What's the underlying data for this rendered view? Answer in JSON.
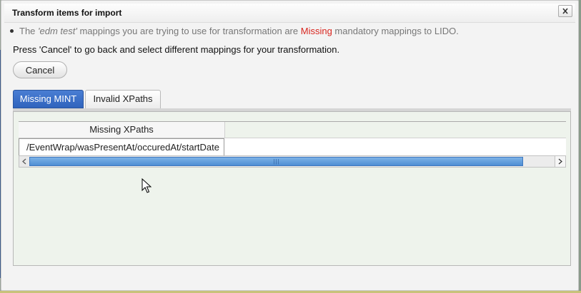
{
  "dialog": {
    "title": "Transform items for import",
    "close_symbol": "✕"
  },
  "message": {
    "part1": "The ",
    "mapping_name": "'edm test'",
    "part2": " mappings you are trying to use for transformation are ",
    "missing_word": "Missing",
    "part3": " mandatory mappings to LIDO.",
    "instruction": "Press 'Cancel' to go back and select different mappings for your transformation."
  },
  "buttons": {
    "cancel_label": "Cancel"
  },
  "tabs": [
    {
      "label": "Missing MINT",
      "active": true
    },
    {
      "label": "Invalid XPaths",
      "active": false
    }
  ],
  "table": {
    "columns": [
      "Missing XPaths"
    ],
    "rows": [
      [
        "/EventWrap/wasPresentAt/occuredAt/startDate"
      ]
    ]
  },
  "scrollbar": {
    "grip": "|||",
    "visible_fraction": 0.94
  },
  "colors": {
    "accent": "#2f63bd",
    "missing_red": "#d8261f",
    "panel_bg": "#eef3ec"
  }
}
